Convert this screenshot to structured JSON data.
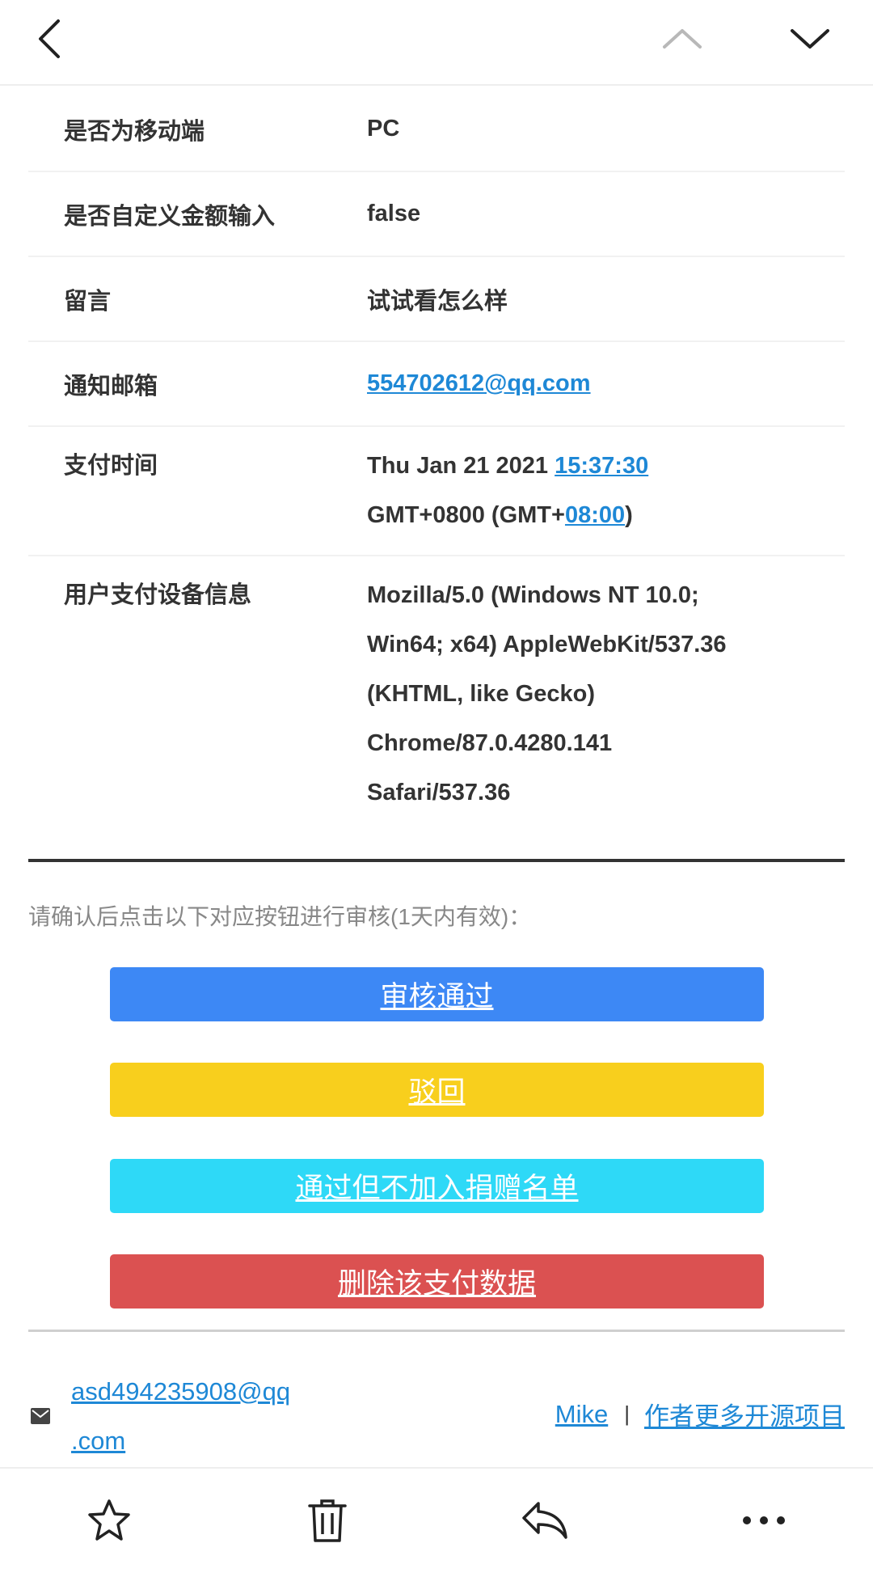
{
  "nav": {
    "icons": [
      "back-chevron-icon",
      "up-chevron-icon",
      "down-chevron-icon"
    ]
  },
  "details": [
    {
      "label": "是否为移动端",
      "value": "PC"
    },
    {
      "label": "是否自定义金额输入",
      "value": "false"
    },
    {
      "label": "留言",
      "value": "试试看怎么样"
    },
    {
      "label": "通知邮箱",
      "value": "554702612@qq.com"
    }
  ],
  "pay_time": {
    "label": "支付时间",
    "date": "Thu Jan 21 2021 ",
    "time": "15:37:30",
    "tz_prefix": "GMT+0800 (GMT+",
    "tz_offset": "08:00",
    "tz_suffix": ")"
  },
  "device": {
    "label": "用户支付设备信息",
    "lines": [
      "Mozilla/5.0 (Windows NT 10.0;",
      "Win64; x64) AppleWebKit/537.36",
      "(KHTML, like Gecko)",
      "Chrome/87.0.4280.141",
      "Safari/537.36"
    ]
  },
  "confirm_text": "请确认后点击以下对应按钮进行审核(1天内有效)：",
  "buttons": {
    "approve": {
      "label": "审核通过",
      "color": "#3d88f5"
    },
    "reject": {
      "label": "驳回",
      "color": "#f8cf1d"
    },
    "pass_no_list": {
      "label": "通过但不加入捐赠名单",
      "color": "#2ed9f7"
    },
    "delete": {
      "label": "删除该支付数据",
      "color": "#db5151"
    }
  },
  "footer": {
    "email_line1": "asd494235908@qq",
    "email_line2": ".com",
    "author": "Mike",
    "separator": "|",
    "more_projects": "作者更多开源项目"
  },
  "toolbar": {
    "icons": [
      "star-icon",
      "trash-icon",
      "reply-icon",
      "more-icon"
    ]
  },
  "colors": {
    "link": "#1e88d6",
    "text": "#333333",
    "muted": "#888888"
  }
}
